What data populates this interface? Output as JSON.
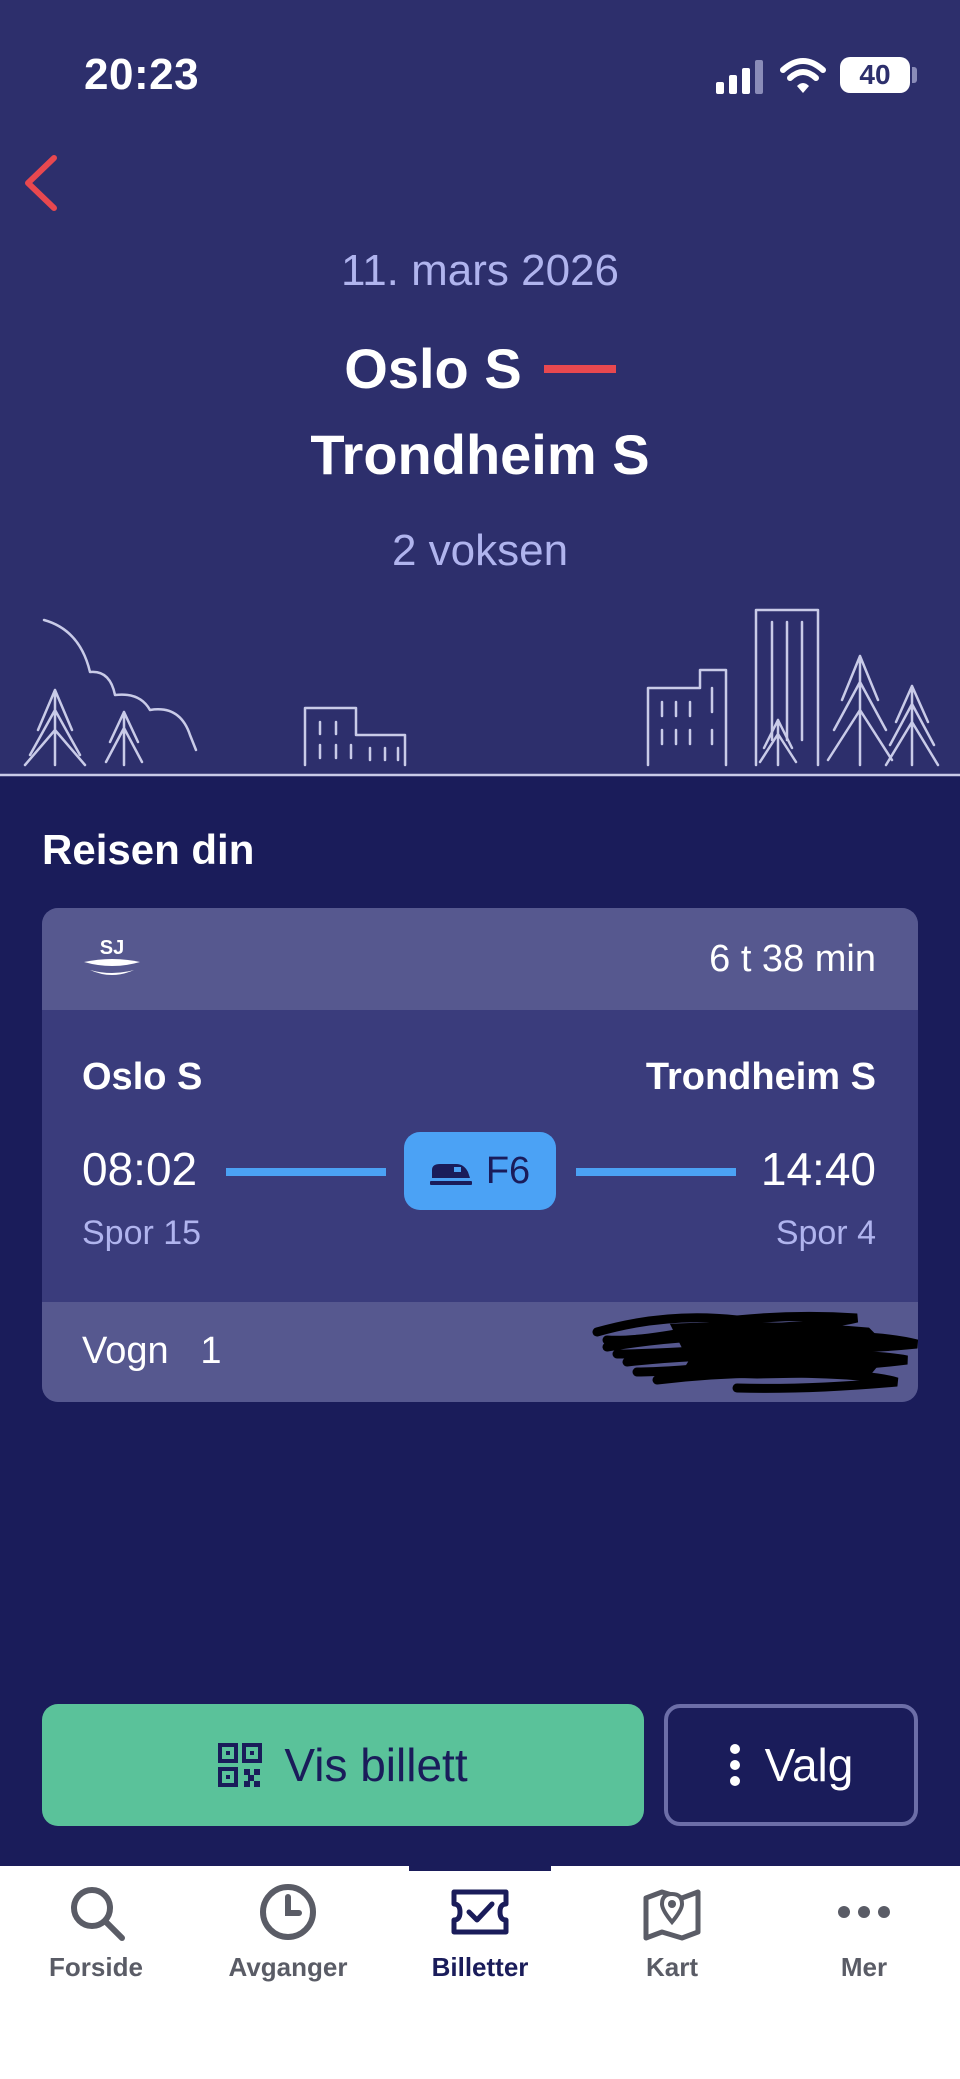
{
  "status_bar": {
    "time": "20:23",
    "battery": "40"
  },
  "trip": {
    "date": "11. mars 2026",
    "from": "Oslo S",
    "to": "Trondheim S",
    "passengers": "2 voksen"
  },
  "section": {
    "title": "Reisen din"
  },
  "journey": {
    "operator_logo": "SJ",
    "duration": "6 t 38 min",
    "from_station": "Oslo S",
    "to_station": "Trondheim S",
    "departure_time": "08:02",
    "arrival_time": "14:40",
    "departure_track": "Spor 15",
    "arrival_track": "Spor 4",
    "train_line": "F6",
    "car_label": "Vogn",
    "car_number": "1"
  },
  "actions": {
    "show_ticket": "Vis billett",
    "options": "Valg"
  },
  "tabs": [
    {
      "label": "Forside",
      "icon": "search-icon"
    },
    {
      "label": "Avganger",
      "icon": "clock-icon"
    },
    {
      "label": "Billetter",
      "icon": "ticket-icon"
    },
    {
      "label": "Kart",
      "icon": "map-icon"
    },
    {
      "label": "Mer",
      "icon": "more-icon"
    }
  ],
  "colors": {
    "header_bg": "#2d2f6c",
    "body_bg": "#1a1c5a",
    "accent_red": "#e8484f",
    "train_blue": "#4ba2f5",
    "primary_green": "#5ac29a"
  }
}
